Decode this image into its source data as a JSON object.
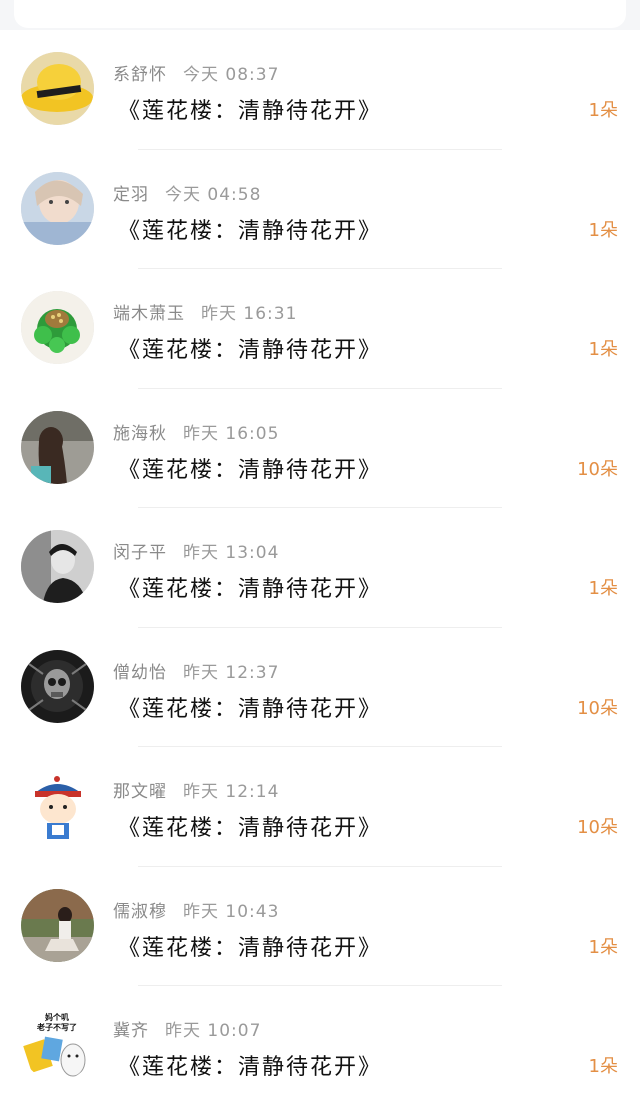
{
  "header": {
    "back_icon": "chevron-left-icon"
  },
  "list": [
    {
      "name": "系舒怀",
      "time": "今天 08:37",
      "title": "《莲花楼：清静待花开》",
      "count": "1朵",
      "avatar": "straw-hat-photo"
    },
    {
      "name": "定羽",
      "time": "今天 04:58",
      "title": "《莲花楼：清静待花开》",
      "count": "1朵",
      "avatar": "girl-selfie-photo"
    },
    {
      "name": "端木萧玉",
      "time": "昨天 16:31",
      "title": "《莲花楼：清静待花开》",
      "count": "1朵",
      "avatar": "leaf-plate-photo"
    },
    {
      "name": "施海秋",
      "time": "昨天 16:05",
      "title": "《莲花楼：清静待花开》",
      "count": "10朵",
      "avatar": "girl-back-photo"
    },
    {
      "name": "闵子平",
      "time": "昨天 13:04",
      "title": "《莲花楼：清静待花开》",
      "count": "1朵",
      "avatar": "bw-man-photo"
    },
    {
      "name": "僧幼怡",
      "time": "昨天 12:37",
      "title": "《莲花楼：清静待花开》",
      "count": "10朵",
      "avatar": "skull-photo"
    },
    {
      "name": "那文曜",
      "time": "昨天 12:14",
      "title": "《莲花楼：清静待花开》",
      "count": "10朵",
      "avatar": "cartoon-qing-official"
    },
    {
      "name": "儒淑穆",
      "time": "昨天 10:43",
      "title": "《莲花楼：清静待花开》",
      "count": "1朵",
      "avatar": "woman-garden-photo"
    },
    {
      "name": "冀齐",
      "time": "昨天 10:07",
      "title": "《莲花楼：清静待花开》",
      "count": "1朵",
      "avatar": "meme-sticker",
      "avatar_text": "妈个叽\n老子不写了"
    }
  ]
}
